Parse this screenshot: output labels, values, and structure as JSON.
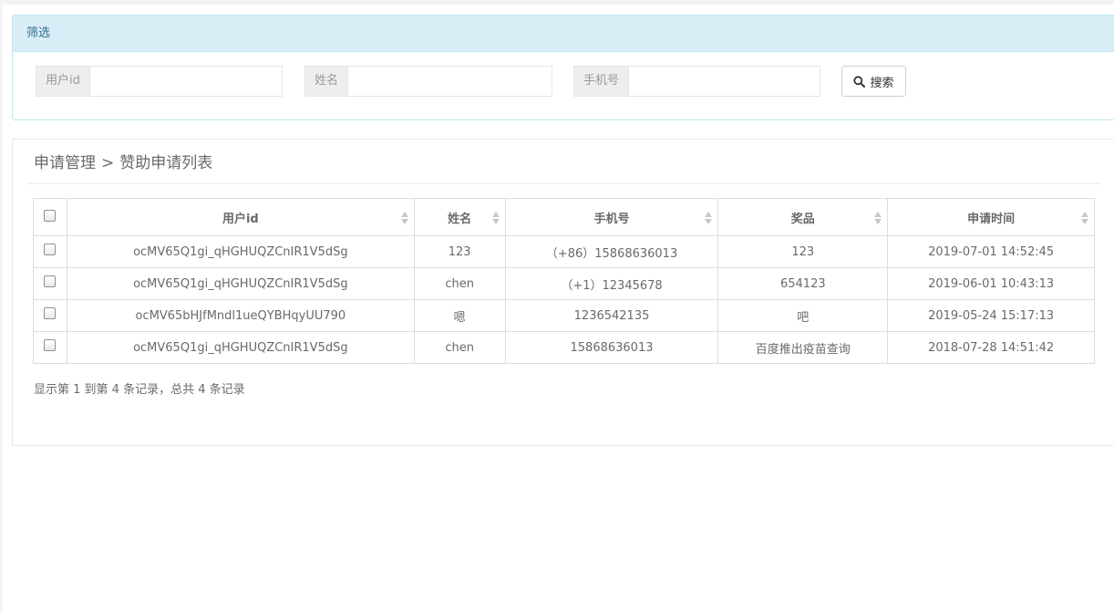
{
  "filter": {
    "title": "筛选",
    "user_id_label": "用户id",
    "name_label": "姓名",
    "phone_label": "手机号",
    "user_id_value": "",
    "name_value": "",
    "phone_value": "",
    "search_label": "搜索"
  },
  "breadcrumb": {
    "parent": "申请管理",
    "separator": ">",
    "current": "赞助申请列表"
  },
  "table": {
    "columns": [
      "用户id",
      "姓名",
      "手机号",
      "奖品",
      "申请时间"
    ],
    "rows": [
      [
        "ocMV65Q1gi_qHGHUQZCnIR1V5dSg",
        "123",
        "（+86）15868636013",
        "123",
        "2019-07-01 14:52:45"
      ],
      [
        "ocMV65Q1gi_qHGHUQZCnIR1V5dSg",
        "chen",
        "（+1）12345678",
        "654123",
        "2019-06-01 10:43:13"
      ],
      [
        "ocMV65bHJfMndl1ueQYBHqyUU790",
        "嗯",
        "1236542135",
        "吧",
        "2019-05-24 15:17:13"
      ],
      [
        "ocMV65Q1gi_qHGHUQZCnIR1V5dSg",
        "chen",
        "15868636013",
        "百度推出疫苗查询",
        "2018-07-28 14:51:42"
      ]
    ]
  },
  "pagination": {
    "summary": "显示第 1 到第 4 条记录，总共 4 条记录"
  },
  "icons": {
    "search": "search-icon",
    "sort": "sort-both-icon"
  },
  "colors": {
    "filter_header_bg": "#d9edf7",
    "filter_header_text": "#31708f",
    "text": "#676a6c"
  }
}
